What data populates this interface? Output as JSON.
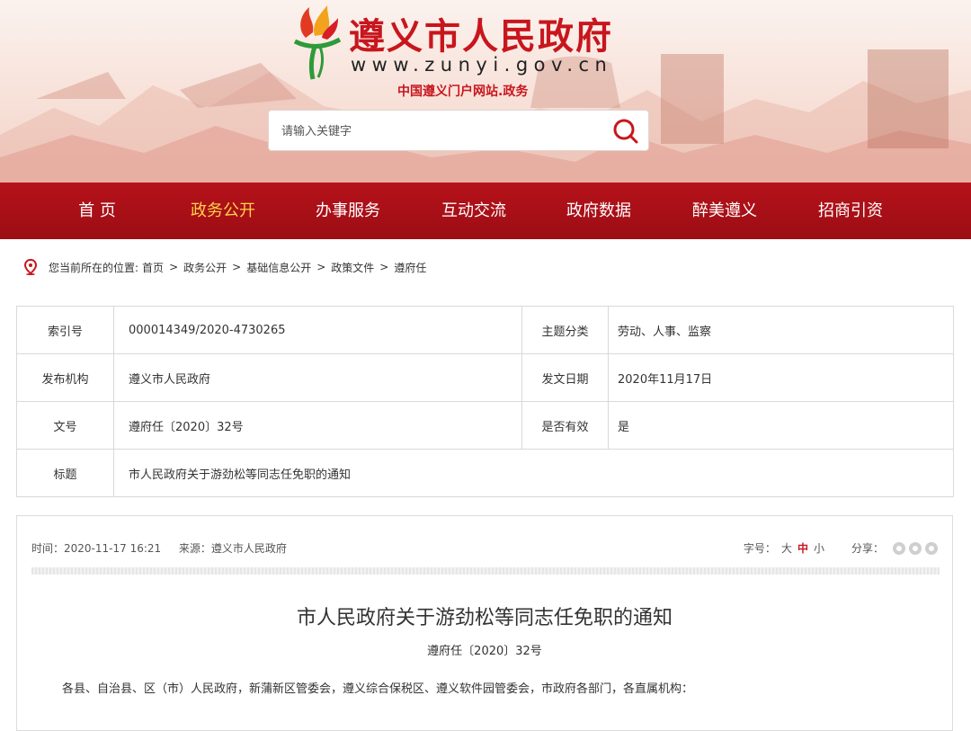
{
  "header": {
    "title": "遵义市人民政府",
    "url": "www.zunyi.gov.cn",
    "subtitle": "中国遵义门户网站.政务",
    "search_placeholder": "请输入关键字"
  },
  "nav": {
    "items": [
      {
        "label": "首 页"
      },
      {
        "label": "政务公开"
      },
      {
        "label": "办事服务"
      },
      {
        "label": "互动交流"
      },
      {
        "label": "政府数据"
      },
      {
        "label": "醉美遵义"
      },
      {
        "label": "招商引资"
      }
    ],
    "active": "政务公开"
  },
  "breadcrumb": {
    "prefix": "您当前所在的位置:",
    "items": [
      "首页",
      "政务公开",
      "基础信息公开",
      "政策文件",
      "遵府任"
    ],
    "separator": ">"
  },
  "meta": {
    "index_label": "索引号",
    "index_value": "000014349/2020-4730265",
    "topic_label": "主题分类",
    "topic_value": "劳动、人事、监察",
    "issuer_label": "发布机构",
    "issuer_value": "遵义市人民政府",
    "date_label": "发文日期",
    "date_value": "2020年11月17日",
    "docno_label": "文号",
    "docno_value": "遵府任〔2020〕32号",
    "valid_label": "是否有效",
    "valid_value": "是",
    "title_label": "标题",
    "title_value": "市人民政府关于游劲松等同志任免职的通知"
  },
  "article": {
    "time_label": "时间：",
    "time_value": "2020-11-17 16:21",
    "source_label": "来源：",
    "source_value": "遵义市人民政府",
    "font_size_label": "字号：",
    "font_sizes": [
      "大",
      "中",
      "小"
    ],
    "font_size_selected": "中",
    "share_label": "分享：",
    "share_icons": [
      "qzone-icon",
      "weibo-icon",
      "wechat-icon"
    ],
    "title": "市人民政府关于游劲松等同志任免职的通知",
    "doc_number": "遵府任〔2020〕32号",
    "body_first_line": "各县、自治县、区（市）人民政府，新蒲新区管委会，遵义综合保税区、遵义软件园管委会，市政府各部门，各直属机构："
  },
  "colors": {
    "brand_red": "#c8161d",
    "nav_red": "#b6121a",
    "nav_active": "#ffd24c"
  }
}
